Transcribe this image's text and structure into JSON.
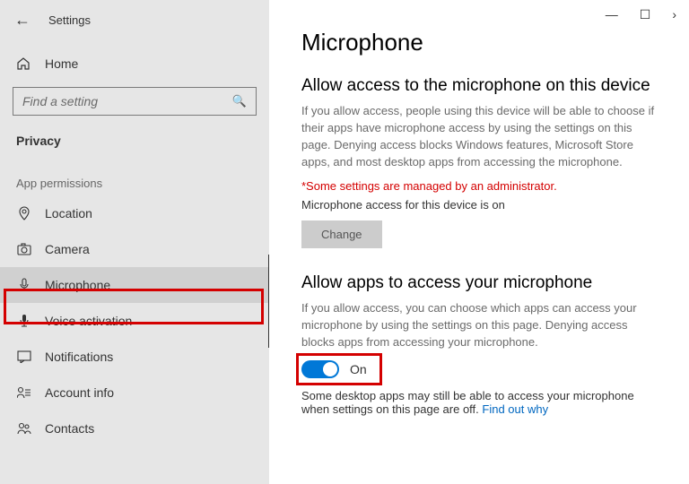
{
  "titlebar": {
    "title": "Settings"
  },
  "home": {
    "label": "Home"
  },
  "search": {
    "placeholder": "Find a setting"
  },
  "section": "Privacy",
  "subheader": "App permissions",
  "nav": {
    "location": "Location",
    "camera": "Camera",
    "microphone": "Microphone",
    "voice": "Voice activation",
    "notifications": "Notifications",
    "account": "Account info",
    "contacts": "Contacts"
  },
  "main": {
    "title": "Microphone",
    "sec1": {
      "heading": "Allow access to the microphone on this device",
      "body": "If you allow access, people using this device will be able to choose if their apps have microphone access by using the settings on this page. Denying access blocks Windows features, Microsoft Store apps, and most desktop apps from accessing the microphone.",
      "admin_note": "*Some settings are managed by an administrator.",
      "status": "Microphone access for this device is on",
      "change_btn": "Change"
    },
    "sec2": {
      "heading": "Allow apps to access your microphone",
      "body": "If you allow access, you can choose which apps can access your microphone by using the settings on this page. Denying access blocks apps from accessing your microphone.",
      "toggle_label": "On",
      "footer_text": "Some desktop apps may still be able to access your microphone when settings on this page are off. ",
      "footer_link": "Find out why"
    }
  },
  "window": {
    "min": "—",
    "max": "☐",
    "close": "›"
  }
}
